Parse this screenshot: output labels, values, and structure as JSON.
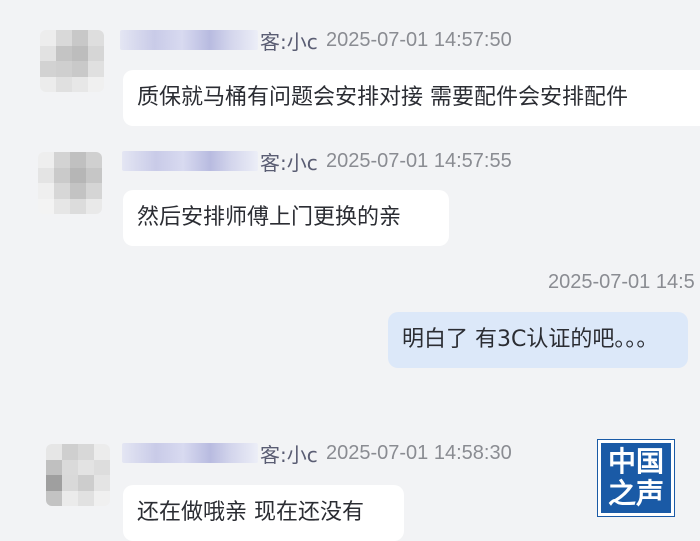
{
  "messages": [
    {
      "sender_suffix": "客:小c",
      "time": "2025-07-01 14:57:50",
      "text": "质保就马桶有问题会安排对接 需要配件会安排配件"
    },
    {
      "sender_suffix": "客:小c",
      "time": "2025-07-01 14:57:55",
      "text": "然后安排师傅上门更换的亲"
    },
    {
      "sender_suffix": "",
      "time": "2025-07-01 14:5",
      "text": "明白了 有3C认证的吧。。。"
    },
    {
      "sender_suffix": "客:小c",
      "time": "2025-07-01 14:58:30",
      "text": "还在做哦亲 现在还没有"
    }
  ],
  "watermark": {
    "line1": "中国",
    "line2": "之声"
  }
}
